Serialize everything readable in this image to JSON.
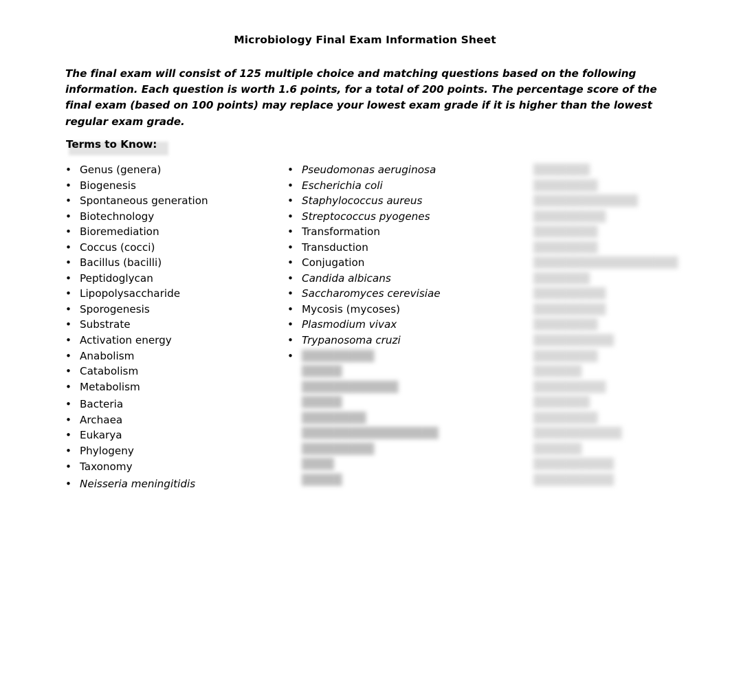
{
  "document": {
    "title": "Microbiology Final Exam Information Sheet",
    "intro": "The final exam will consist of 125 multiple choice and matching questions based on the following information.  Each question is worth 1.6 points, for a total of 200 points.   The percentage score of the final exam (based on 100 points) may replace your lowest exam grade if it is higher than the lowest regular exam grade.",
    "terms_heading": "Terms to Know:",
    "bullet_glyph": "•",
    "highlight_color": "#e3e3e3",
    "text_color": "#000000",
    "blur_text_color": "#b9b9b9"
  },
  "columns": [
    {
      "name": "terms-column-1",
      "items": [
        {
          "label": "Genus (genera)",
          "italic": false,
          "blurred": false,
          "bullet": true
        },
        {
          "label": "Biogenesis",
          "italic": false,
          "blurred": false,
          "bullet": true
        },
        {
          "label": "Spontaneous generation",
          "italic": false,
          "blurred": false,
          "bullet": true
        },
        {
          "label": "Biotechnology",
          "italic": false,
          "blurred": false,
          "bullet": true
        },
        {
          "label": "Bioremediation",
          "italic": false,
          "blurred": false,
          "bullet": true
        },
        {
          "label": "Coccus (cocci)",
          "italic": false,
          "blurred": false,
          "bullet": true
        },
        {
          "label": "Bacillus (bacilli)",
          "italic": false,
          "blurred": false,
          "bullet": true
        },
        {
          "label": "Peptidoglycan",
          "italic": false,
          "blurred": false,
          "bullet": true
        },
        {
          "label": "Lipopolysaccharide",
          "italic": false,
          "blurred": false,
          "bullet": true
        },
        {
          "label": "Sporogenesis",
          "italic": false,
          "blurred": false,
          "bullet": true
        },
        {
          "label": "Substrate",
          "italic": false,
          "blurred": false,
          "bullet": true
        },
        {
          "label": "Activation energy",
          "italic": false,
          "blurred": false,
          "bullet": true
        },
        {
          "label": "Anabolism",
          "italic": false,
          "blurred": false,
          "bullet": true
        },
        {
          "label": "Catabolism",
          "italic": false,
          "blurred": false,
          "bullet": true
        },
        {
          "label": "Metabolism",
          "italic": false,
          "blurred": false,
          "bullet": true
        },
        {
          "label": "Bacteria",
          "italic": false,
          "blurred": false,
          "bullet": true,
          "gap_before": true
        },
        {
          "label": "Archaea",
          "italic": false,
          "blurred": false,
          "bullet": true
        },
        {
          "label": "Eukarya",
          "italic": false,
          "blurred": false,
          "bullet": true
        },
        {
          "label": "Phylogeny",
          "italic": false,
          "blurred": false,
          "bullet": true
        },
        {
          "label": "Taxonomy",
          "italic": false,
          "blurred": false,
          "bullet": true
        },
        {
          "label": "Neisseria meningitidis",
          "italic": true,
          "blurred": false,
          "bullet": true,
          "gap_before": true
        }
      ]
    },
    {
      "name": "terms-column-2",
      "items": [
        {
          "label": "Pseudomonas aeruginosa",
          "italic": true,
          "blurred": false,
          "bullet": true
        },
        {
          "label": "Escherichia coli",
          "italic": true,
          "blurred": false,
          "bullet": true
        },
        {
          "label": "Staphylococcus aureus",
          "italic": true,
          "blurred": false,
          "bullet": true
        },
        {
          "label": "Streptococcus pyogenes",
          "italic": true,
          "blurred": false,
          "bullet": true
        },
        {
          "label": "Transformation",
          "italic": false,
          "blurred": false,
          "bullet": true
        },
        {
          "label": "Transduction",
          "italic": false,
          "blurred": false,
          "bullet": true
        },
        {
          "label": "Conjugation",
          "italic": false,
          "blurred": false,
          "bullet": true
        },
        {
          "label": "Candida albicans",
          "italic": true,
          "blurred": false,
          "bullet": true
        },
        {
          "label": "Saccharomyces cerevisiae",
          "italic": true,
          "blurred": false,
          "bullet": true
        },
        {
          "label": "Mycosis (mycoses)",
          "italic": false,
          "blurred": false,
          "bullet": true
        },
        {
          "label": "Plasmodium vivax",
          "italic": true,
          "blurred": false,
          "bullet": true
        },
        {
          "label": "Trypanosoma cruzi",
          "italic": true,
          "blurred": false,
          "bullet": true
        },
        {
          "label": "█████████",
          "italic": false,
          "blurred": true,
          "bullet": true
        },
        {
          "label": "█████",
          "italic": false,
          "blurred": true,
          "bullet": false
        },
        {
          "label": "████████████",
          "italic": false,
          "blurred": true,
          "bullet": false
        },
        {
          "label": "█████",
          "italic": false,
          "blurred": true,
          "bullet": false
        },
        {
          "label": "████████",
          "italic": false,
          "blurred": true,
          "bullet": false
        },
        {
          "label": "█████████████████",
          "italic": false,
          "blurred": true,
          "bullet": false
        },
        {
          "label": "█████████",
          "italic": false,
          "blurred": true,
          "bullet": false
        },
        {
          "label": "████",
          "italic": false,
          "blurred": true,
          "bullet": false
        },
        {
          "label": "█████",
          "italic": false,
          "blurred": true,
          "bullet": false
        }
      ]
    },
    {
      "name": "terms-column-3",
      "items": [
        {
          "label": "███████",
          "italic": false,
          "blurred": true,
          "bullet": false
        },
        {
          "label": "████████",
          "italic": false,
          "blurred": true,
          "bullet": false
        },
        {
          "label": "█████████████",
          "italic": false,
          "blurred": true,
          "bullet": false
        },
        {
          "label": "█████████",
          "italic": false,
          "blurred": true,
          "bullet": false
        },
        {
          "label": "████████",
          "italic": false,
          "blurred": true,
          "bullet": false
        },
        {
          "label": "████████",
          "italic": false,
          "blurred": true,
          "bullet": false
        },
        {
          "label": "██████████████████",
          "italic": false,
          "blurred": true,
          "bullet": false
        },
        {
          "label": "███████",
          "italic": false,
          "blurred": true,
          "bullet": false
        },
        {
          "label": "█████████",
          "italic": false,
          "blurred": true,
          "bullet": false
        },
        {
          "label": "█████████",
          "italic": false,
          "blurred": true,
          "bullet": false
        },
        {
          "label": "████████",
          "italic": false,
          "blurred": true,
          "bullet": false
        },
        {
          "label": "██████████",
          "italic": false,
          "blurred": true,
          "bullet": false
        },
        {
          "label": "████████",
          "italic": false,
          "blurred": true,
          "bullet": false
        },
        {
          "label": "██████",
          "italic": false,
          "blurred": true,
          "bullet": false
        },
        {
          "label": "█████████",
          "italic": false,
          "blurred": true,
          "bullet": false
        },
        {
          "label": "███████",
          "italic": false,
          "blurred": true,
          "bullet": false
        },
        {
          "label": "████████",
          "italic": false,
          "blurred": true,
          "bullet": false
        },
        {
          "label": "███████████",
          "italic": false,
          "blurred": true,
          "bullet": false
        },
        {
          "label": "██████",
          "italic": false,
          "blurred": true,
          "bullet": false
        },
        {
          "label": "██████████",
          "italic": false,
          "blurred": true,
          "bullet": false
        },
        {
          "label": "██████████",
          "italic": false,
          "blurred": true,
          "bullet": false
        }
      ]
    }
  ]
}
